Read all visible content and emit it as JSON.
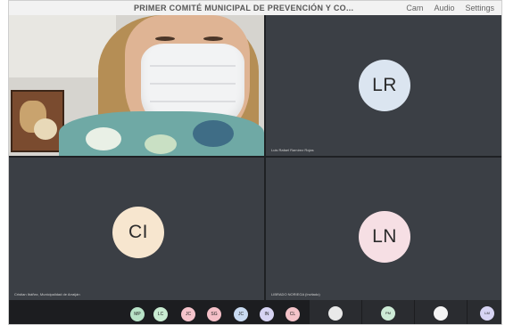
{
  "window": {
    "title": "PRIMER COMITÉ MUNICIPAL DE PREVENCIÓN Y CO...",
    "controls": [
      "Cam",
      "Audio",
      "Settings"
    ]
  },
  "tiles": [
    {
      "id": "video",
      "name": ""
    },
    {
      "id": "lr",
      "initials": "LR",
      "name": "Luis Rafael Ramírez Rojas",
      "color": "#dbe5f0"
    },
    {
      "id": "ci",
      "initials": "CI",
      "name": "Cristian Ibáñez, Municipalidad de Arraiján",
      "color": "#f7e6cf"
    },
    {
      "id": "ln",
      "initials": "LN",
      "name": "LIBRADO NORIEGA (Invitado)",
      "color": "#f6dfe4"
    }
  ],
  "participants_strip": [
    {
      "initials": "MP",
      "color": "#b9e3c8"
    },
    {
      "initials": "LC",
      "color": "#c9ecd2"
    },
    {
      "initials": "JC",
      "color": "#f6c4cc"
    },
    {
      "initials": "SG",
      "color": "#f5c0c8"
    },
    {
      "initials": "JC",
      "color": "#c9dbf2"
    },
    {
      "initials": "IN",
      "color": "#d7d4f3"
    },
    {
      "initials": "CL",
      "color": "#f4c3c9"
    }
  ],
  "thumbs": [
    {
      "label": "",
      "initials": ""
    },
    {
      "label": "",
      "initials": "PM"
    },
    {
      "label": "",
      "initials": ""
    },
    {
      "label": "",
      "initials": "LM"
    }
  ]
}
